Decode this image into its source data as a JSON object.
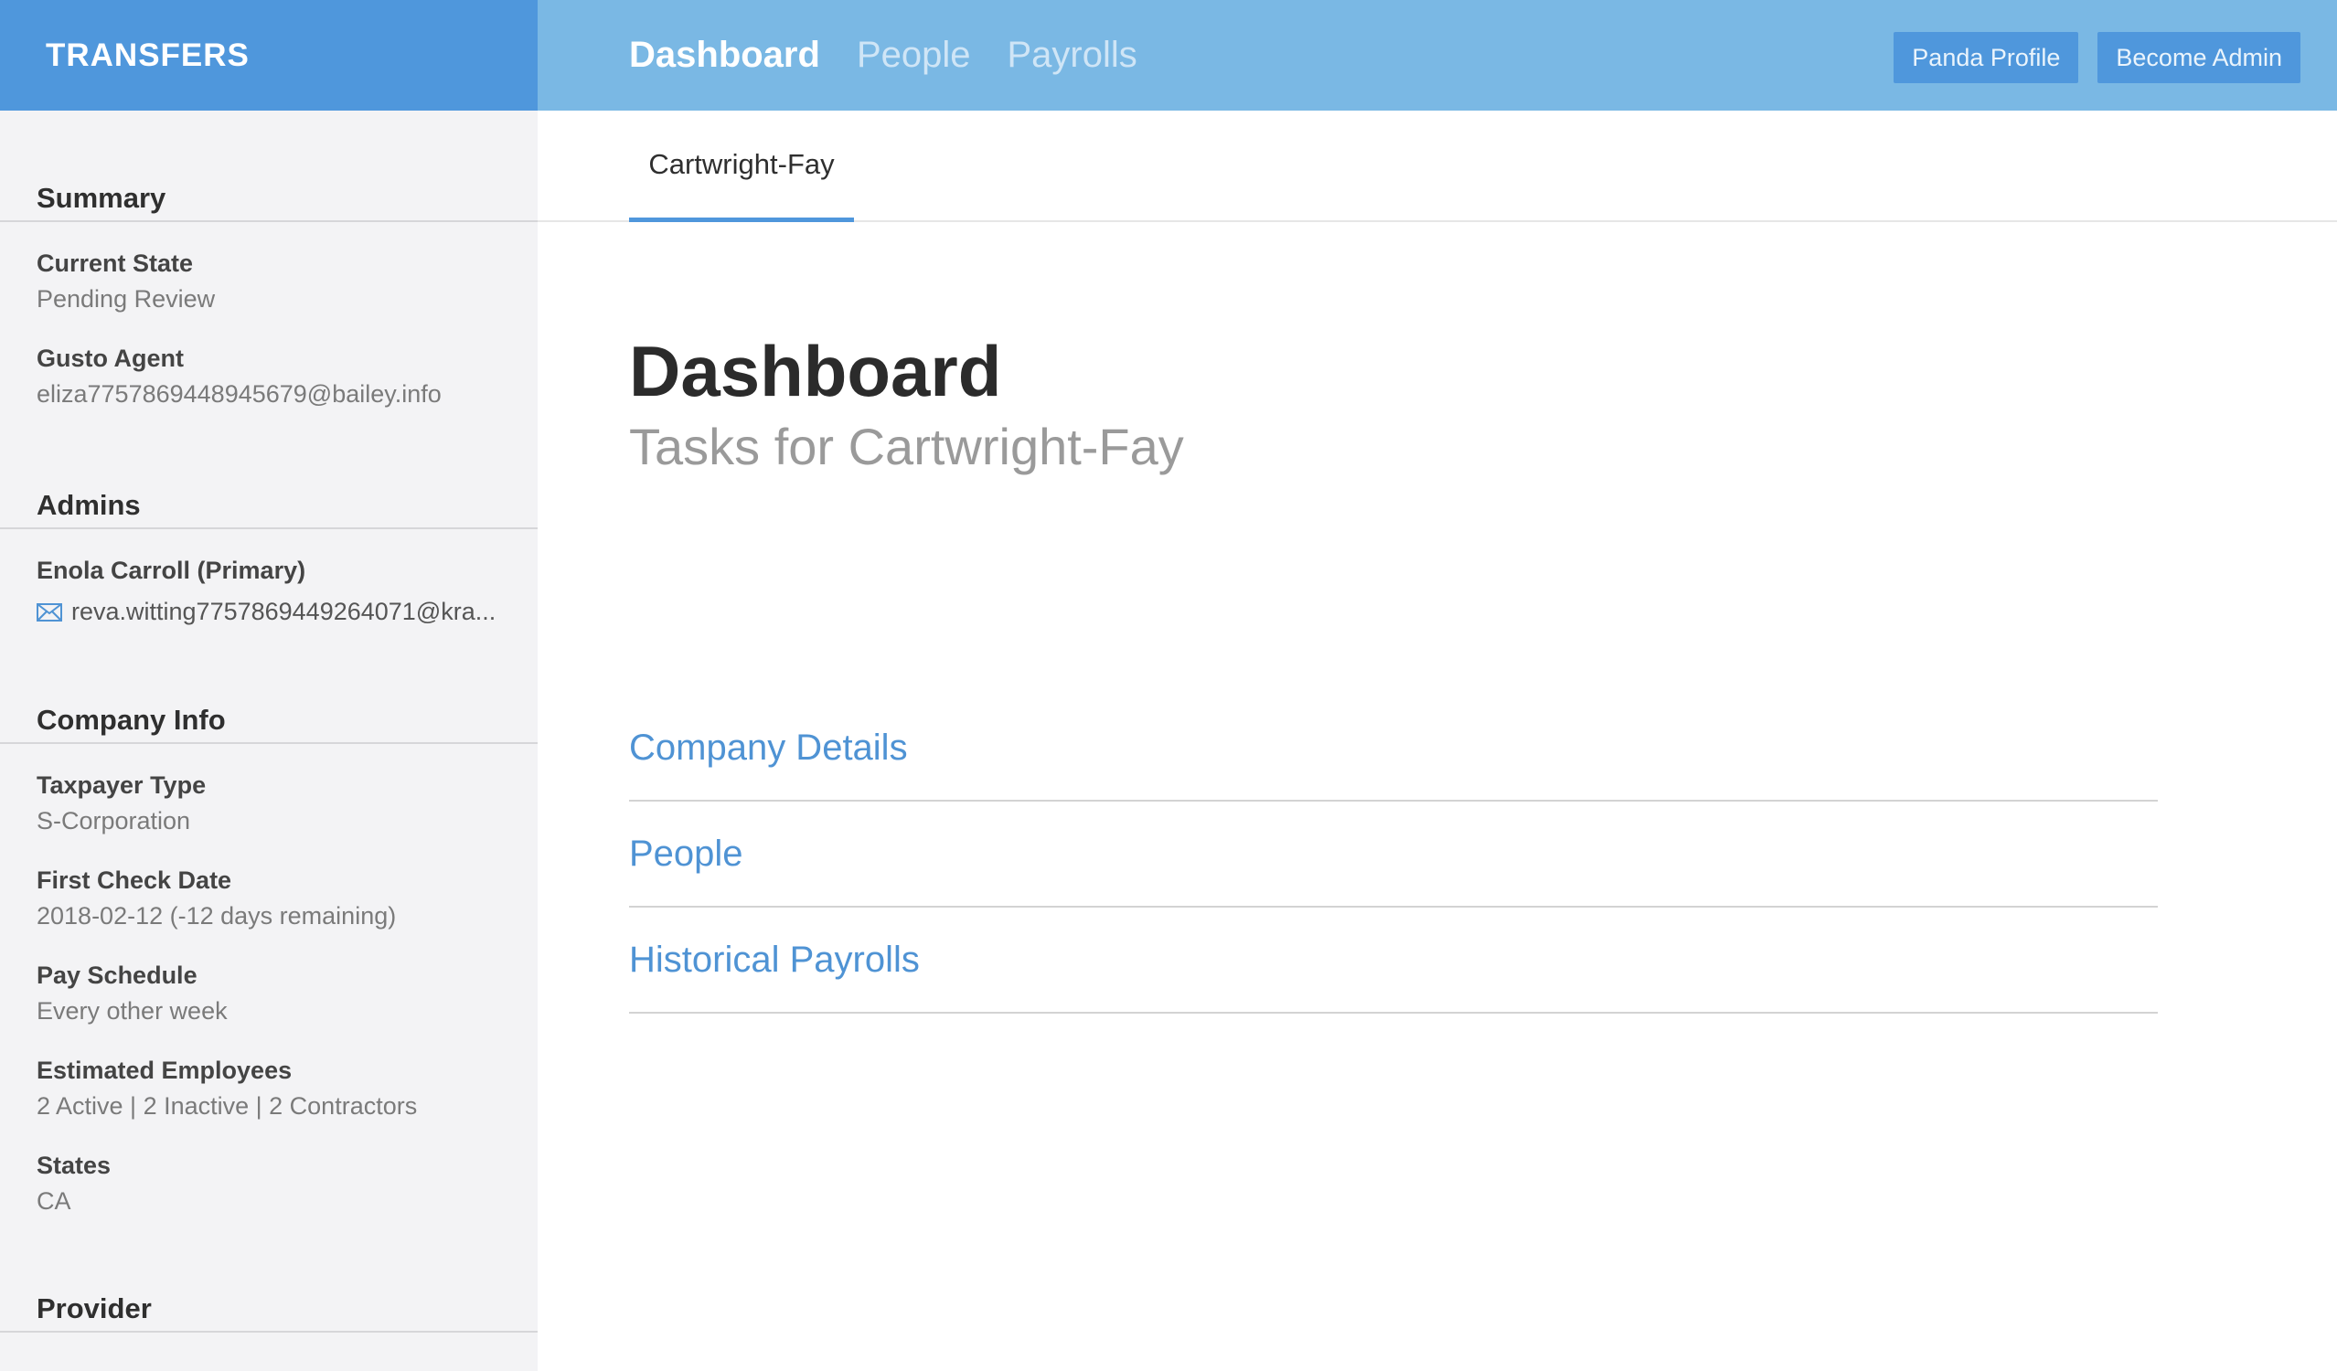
{
  "brand": {
    "title": "TRANSFERS"
  },
  "nav": {
    "items": [
      {
        "label": "Dashboard",
        "active": true
      },
      {
        "label": "People",
        "active": false
      },
      {
        "label": "Payrolls",
        "active": false
      }
    ]
  },
  "top_actions": {
    "profile_label": "Panda Profile",
    "admin_label": "Become Admin"
  },
  "sidebar": {
    "summary": {
      "title": "Summary",
      "current_state_label": "Current State",
      "current_state_value": "Pending Review",
      "agent_label": "Gusto Agent",
      "agent_value": "eliza7757869448945679@bailey.info"
    },
    "admins": {
      "title": "Admins",
      "name": "Enola Carroll (Primary)",
      "email": "reva.witting7757869449264071@kra..."
    },
    "company_info": {
      "title": "Company Info",
      "fields": [
        {
          "label": "Taxpayer Type",
          "value": "S-Corporation"
        },
        {
          "label": "First Check Date",
          "value": "2018-02-12 (-12 days remaining)"
        },
        {
          "label": "Pay Schedule",
          "value": "Every other week"
        },
        {
          "label": "Estimated Employees",
          "value": "2 Active | 2 Inactive | 2 Contractors"
        },
        {
          "label": "States",
          "value": "CA"
        }
      ]
    },
    "provider": {
      "title": "Provider"
    }
  },
  "main": {
    "tab_label": "Cartwright-Fay",
    "title": "Dashboard",
    "subtitle": "Tasks for Cartwright-Fay",
    "tasks": [
      {
        "label": "Company Details"
      },
      {
        "label": "People"
      },
      {
        "label": "Historical Payrolls"
      }
    ]
  },
  "colors": {
    "brand_bg": "#4f97dc",
    "topbar_bg": "#7ab8e4",
    "link": "#4f93d4",
    "sidebar_bg": "#f3f3f5"
  },
  "icons": {
    "admin_email": "mail-icon"
  }
}
